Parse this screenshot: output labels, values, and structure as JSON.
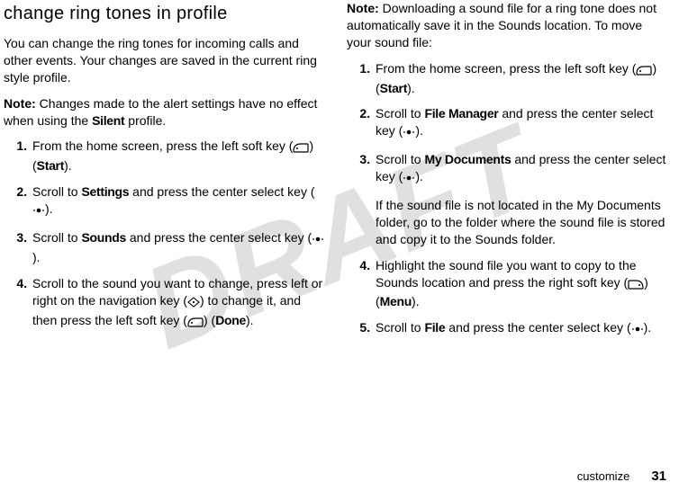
{
  "watermark": "DRAFT",
  "left": {
    "heading": "change ring tones in profile",
    "intro": "You can change the ring tones for incoming calls and other events. Your changes are saved in the current ring style profile.",
    "note_label": "Note:",
    "note_body": " Changes made to the alert settings have no effect when using the ",
    "note_profile": "Silent",
    "note_tail": " profile.",
    "steps": {
      "s1a": "From the home screen, press the left soft key (",
      "s1b": ") (",
      "s1c": "Start",
      "s1d": ").",
      "s2a": "Scroll to ",
      "s2b": "Settings",
      "s2c": " and press the center select key (",
      "s2d": ").",
      "s3a": "Scroll to ",
      "s3b": "Sounds",
      "s3c": " and press the center select key (",
      "s3d": ").",
      "s4a": "Scroll to the sound you want to change, press left or right on the navigation key (",
      "s4b": ") to change it, and then press the left soft key (",
      "s4c": ") (",
      "s4d": "Done",
      "s4e": ")."
    }
  },
  "right": {
    "note_label": "Note:",
    "note_body": " Downloading a sound file for a ring tone does not automatically save it in the Sounds location. To move your sound file:",
    "steps": {
      "s1a": "From the home screen, press the left soft key (",
      "s1b": ") (",
      "s1c": "Start",
      "s1d": ").",
      "s2a": "Scroll to ",
      "s2b": "File Manager",
      "s2c": " and press the center select key (",
      "s2d": ").",
      "s3a": "Scroll to ",
      "s3b": "My Documents",
      "s3c": " and press the center select key (",
      "s3d": ").",
      "s3_para": "If the sound file is not located in the My Documents folder, go to the folder where the sound file is stored and copy it to the Sounds folder.",
      "s4a": "Highlight the sound file you want to copy to the Sounds location and press the right soft key (",
      "s4b": ") (",
      "s4c": "Menu",
      "s4d": ").",
      "s5a": "Scroll to ",
      "s5b": "File",
      "s5c": " and press the center select key (",
      "s5d": ")."
    }
  },
  "footer": {
    "section": "customize",
    "page": "31"
  }
}
